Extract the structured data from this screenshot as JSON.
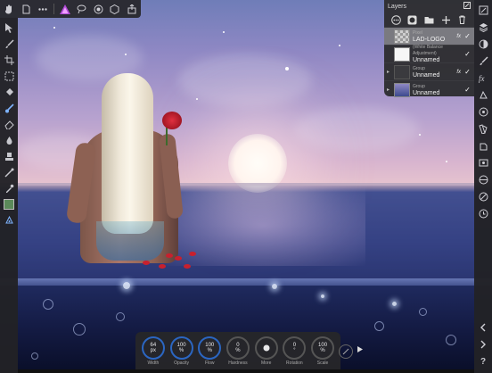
{
  "toolbar": {
    "icons": [
      "hand-icon",
      "document-icon",
      "more-icon",
      "affinity-persona-icon",
      "lasso-icon",
      "selection-icon",
      "mask-icon",
      "export-icon"
    ]
  },
  "layers_panel": {
    "title": "Layers",
    "layers": [
      {
        "type": "Pixel",
        "name": "LAD-LOGO",
        "fx": "fx",
        "visible": true,
        "selected": true
      },
      {
        "type": "(White Balance Adjustment)",
        "name": "Unnamed",
        "fx": "",
        "visible": true,
        "selected": false
      },
      {
        "type": "Group",
        "name": "Unnamed",
        "fx": "fx",
        "visible": true,
        "selected": false
      },
      {
        "type": "Group",
        "name": "Unnamed",
        "fx": "",
        "visible": true,
        "selected": false
      }
    ]
  },
  "context_toolbar": {
    "controls": [
      {
        "value": "64",
        "unit": "px",
        "label": "Width",
        "active": true
      },
      {
        "value": "100",
        "unit": "%",
        "label": "Opacity",
        "active": true
      },
      {
        "value": "100",
        "unit": "%",
        "label": "Flow",
        "active": true
      },
      {
        "value": "0",
        "unit": "%",
        "label": "Hardness",
        "active": false
      },
      {
        "value": "",
        "unit": "",
        "label": "More",
        "active": false
      },
      {
        "value": "0",
        "unit": "°",
        "label": "Rotation",
        "active": false
      },
      {
        "value": "100",
        "unit": "%",
        "label": "Scale",
        "active": false
      }
    ]
  },
  "right_toolbar": {
    "help_label": "?"
  },
  "colors": {
    "accent": "#2b66c2",
    "panel_bg": "#2e2e32",
    "selected_layer": "#7a7a80"
  }
}
